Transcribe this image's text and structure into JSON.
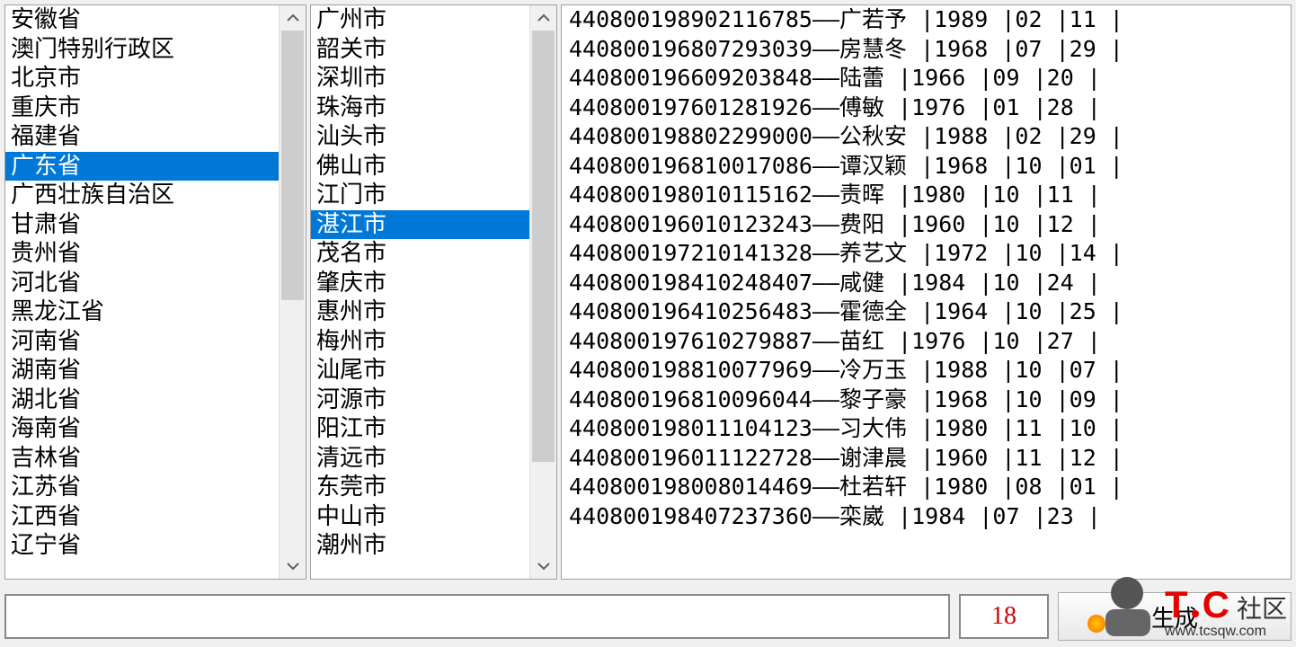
{
  "provinces": {
    "items": [
      "安徽省",
      "澳门特别行政区",
      "北京市",
      "重庆市",
      "福建省",
      "广东省",
      "广西壮族自治区",
      "甘肃省",
      "贵州省",
      "河北省",
      "黑龙江省",
      "河南省",
      "湖南省",
      "湖北省",
      "海南省",
      "吉林省",
      "江苏省",
      "江西省",
      "辽宁省"
    ],
    "selectedIndex": 5
  },
  "cities": {
    "items": [
      "广州市",
      "韶关市",
      "深圳市",
      "珠海市",
      "汕头市",
      "佛山市",
      "江门市",
      "湛江市",
      "茂名市",
      "肇庆市",
      "惠州市",
      "梅州市",
      "汕尾市",
      "河源市",
      "阳江市",
      "清远市",
      "东莞市",
      "中山市",
      "潮州市"
    ],
    "selectedIndex": 7
  },
  "results": [
    {
      "id": "440800198902116785",
      "name": "广若予",
      "year": "1989",
      "month": "02",
      "day": "11"
    },
    {
      "id": "440800196807293039",
      "name": "房慧冬",
      "year": "1968",
      "month": "07",
      "day": "29"
    },
    {
      "id": "440800196609203848",
      "name": "陆蕾",
      "year": "1966",
      "month": "09",
      "day": "20"
    },
    {
      "id": "440800197601281926",
      "name": "傅敏",
      "year": "1976",
      "month": "01",
      "day": "28"
    },
    {
      "id": "440800198802299000",
      "name": "公秋安",
      "year": "1988",
      "month": "02",
      "day": "29"
    },
    {
      "id": "440800196810017086",
      "name": "谭汉颖",
      "year": "1968",
      "month": "10",
      "day": "01"
    },
    {
      "id": "440800198010115162",
      "name": "责晖",
      "year": "1980",
      "month": "10",
      "day": "11"
    },
    {
      "id": "440800196010123243",
      "name": "费阳",
      "year": "1960",
      "month": "10",
      "day": "12"
    },
    {
      "id": "440800197210141328",
      "name": "养艺文",
      "year": "1972",
      "month": "10",
      "day": "14"
    },
    {
      "id": "440800198410248407",
      "name": "咸健",
      "year": "1984",
      "month": "10",
      "day": "24"
    },
    {
      "id": "440800196410256483",
      "name": "霍德全",
      "year": "1964",
      "month": "10",
      "day": "25"
    },
    {
      "id": "440800197610279887",
      "name": "苗红",
      "year": "1976",
      "month": "10",
      "day": "27"
    },
    {
      "id": "440800198810077969",
      "name": "冷万玉",
      "year": "1988",
      "month": "10",
      "day": "07"
    },
    {
      "id": "440800196810096044",
      "name": "黎子豪",
      "year": "1968",
      "month": "10",
      "day": "09"
    },
    {
      "id": "440800198011104123",
      "name": "习大伟",
      "year": "1980",
      "month": "11",
      "day": "10"
    },
    {
      "id": "440800196011122728",
      "name": "谢津晨",
      "year": "1960",
      "month": "11",
      "day": "12"
    },
    {
      "id": "440800198008014469",
      "name": "杜若轩",
      "year": "1980",
      "month": "08",
      "day": "01"
    },
    {
      "id": "440800198407237360",
      "name": "栾崴",
      "year": "1984",
      "month": "07",
      "day": "23"
    }
  ],
  "bottom": {
    "text_value": "",
    "count_value": "18",
    "button_label": "生成"
  },
  "watermark": {
    "brand1": "T",
    "brand2": "C",
    "label": "社区",
    "url": "www.tcsqw.com"
  }
}
